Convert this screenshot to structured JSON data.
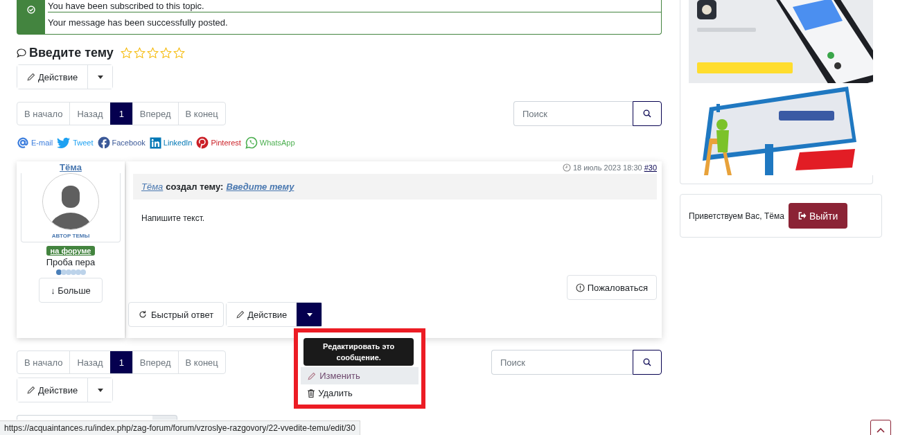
{
  "alert": {
    "messages": [
      "You have been subscribed to this topic.",
      "Your message has been successfully posted."
    ]
  },
  "topic": {
    "title": "Введите тему",
    "stars": 0
  },
  "action_top": {
    "label": "Действие"
  },
  "pagination_top": [
    {
      "label": "В начало",
      "selected": false
    },
    {
      "label": "Назад",
      "selected": false
    },
    {
      "label": "1",
      "selected": true
    },
    {
      "label": "Вперед",
      "selected": false
    },
    {
      "label": "В конец",
      "selected": false
    }
  ],
  "search_top": {
    "placeholder": "Поиск"
  },
  "share": [
    {
      "kind": "email",
      "label": "E-mail",
      "color": "#3b7ddd"
    },
    {
      "kind": "twitter",
      "label": "Tweet",
      "color": "#1da1f2"
    },
    {
      "kind": "facebook",
      "label": "Facebook",
      "color": "#3b5998"
    },
    {
      "kind": "linkedin",
      "label": "LinkedIn",
      "color": "#0077b5"
    },
    {
      "kind": "pinterest",
      "label": "Pinterest",
      "color": "#cb2027"
    },
    {
      "kind": "whatsapp",
      "label": "WhatsApp",
      "color": "#4caf50"
    }
  ],
  "post": {
    "author": {
      "name": "Тёма",
      "role": "АВТОР ТЕМЫ",
      "status": "на форуме",
      "rank": "Проба пера",
      "rank_dots": [
        {
          "filled": true
        },
        {
          "filled": false
        },
        {
          "filled": false
        },
        {
          "filled": false
        },
        {
          "filled": false
        },
        {
          "filled": false
        }
      ],
      "more_button": "↓ Больше"
    },
    "timestamp": "18 июль 2023 18:30",
    "permalink": "#30",
    "header": {
      "author": "Тёма",
      "action": "создал тему:",
      "topic": "Введите тему"
    },
    "body": "Напишите текст.",
    "report_button": "Пожаловаться",
    "quick_reply": "Быстрый ответ",
    "action_button": "Действие",
    "menu_open": true,
    "menu": {
      "items": [
        {
          "kind": "edit",
          "label": "Изменить",
          "selected": true
        },
        {
          "kind": "delete",
          "label": "Удалить",
          "selected": false
        }
      ],
      "tooltip": "Редактировать это сообщение."
    }
  },
  "pagination_bottom": [
    {
      "label": "В начало",
      "selected": false
    },
    {
      "label": "Назад",
      "selected": false
    },
    {
      "label": "1",
      "selected": true
    },
    {
      "label": "Вперед",
      "selected": false
    },
    {
      "label": "В конец",
      "selected": false
    }
  ],
  "search_bottom": {
    "placeholder": "Поиск"
  },
  "action_bottom": {
    "label": "Действие"
  },
  "sidebar": {
    "greeting": "Приветствуем Вас, Тёма",
    "logout_button": "Выйти"
  },
  "status_bar": {
    "url": "https://acquaintances.ru/index.php/zag-forum/forum/vzroslye-razgovory/22-vvedite-temu/edit/30"
  }
}
